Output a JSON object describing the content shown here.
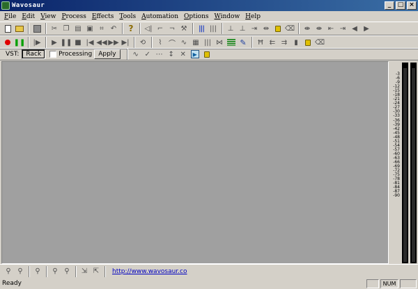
{
  "window": {
    "title": "Wavosaur"
  },
  "menu": [
    "File",
    "Edit",
    "View",
    "Process",
    "Effects",
    "Tools",
    "Automation",
    "Options",
    "Window",
    "Help"
  ],
  "vst": {
    "label": "VST:",
    "rack_button": "Rack",
    "processing_label": "Processing",
    "apply_button": "Apply"
  },
  "vu_scale": [
    "-3",
    "-6",
    "-9",
    "-12",
    "-15",
    "-18",
    "-21",
    "-24",
    "-27",
    "-30",
    "-33",
    "-36",
    "-39",
    "-42",
    "-45",
    "-48",
    "-51",
    "-54",
    "-57",
    "-60",
    "-63",
    "-66",
    "-69",
    "-72",
    "-75",
    "-78",
    "-81",
    "-84",
    "-87",
    "-90"
  ],
  "bottom": {
    "link": "http://www.wavosaur.co"
  },
  "status": {
    "text": "Ready",
    "num": "NUM"
  }
}
